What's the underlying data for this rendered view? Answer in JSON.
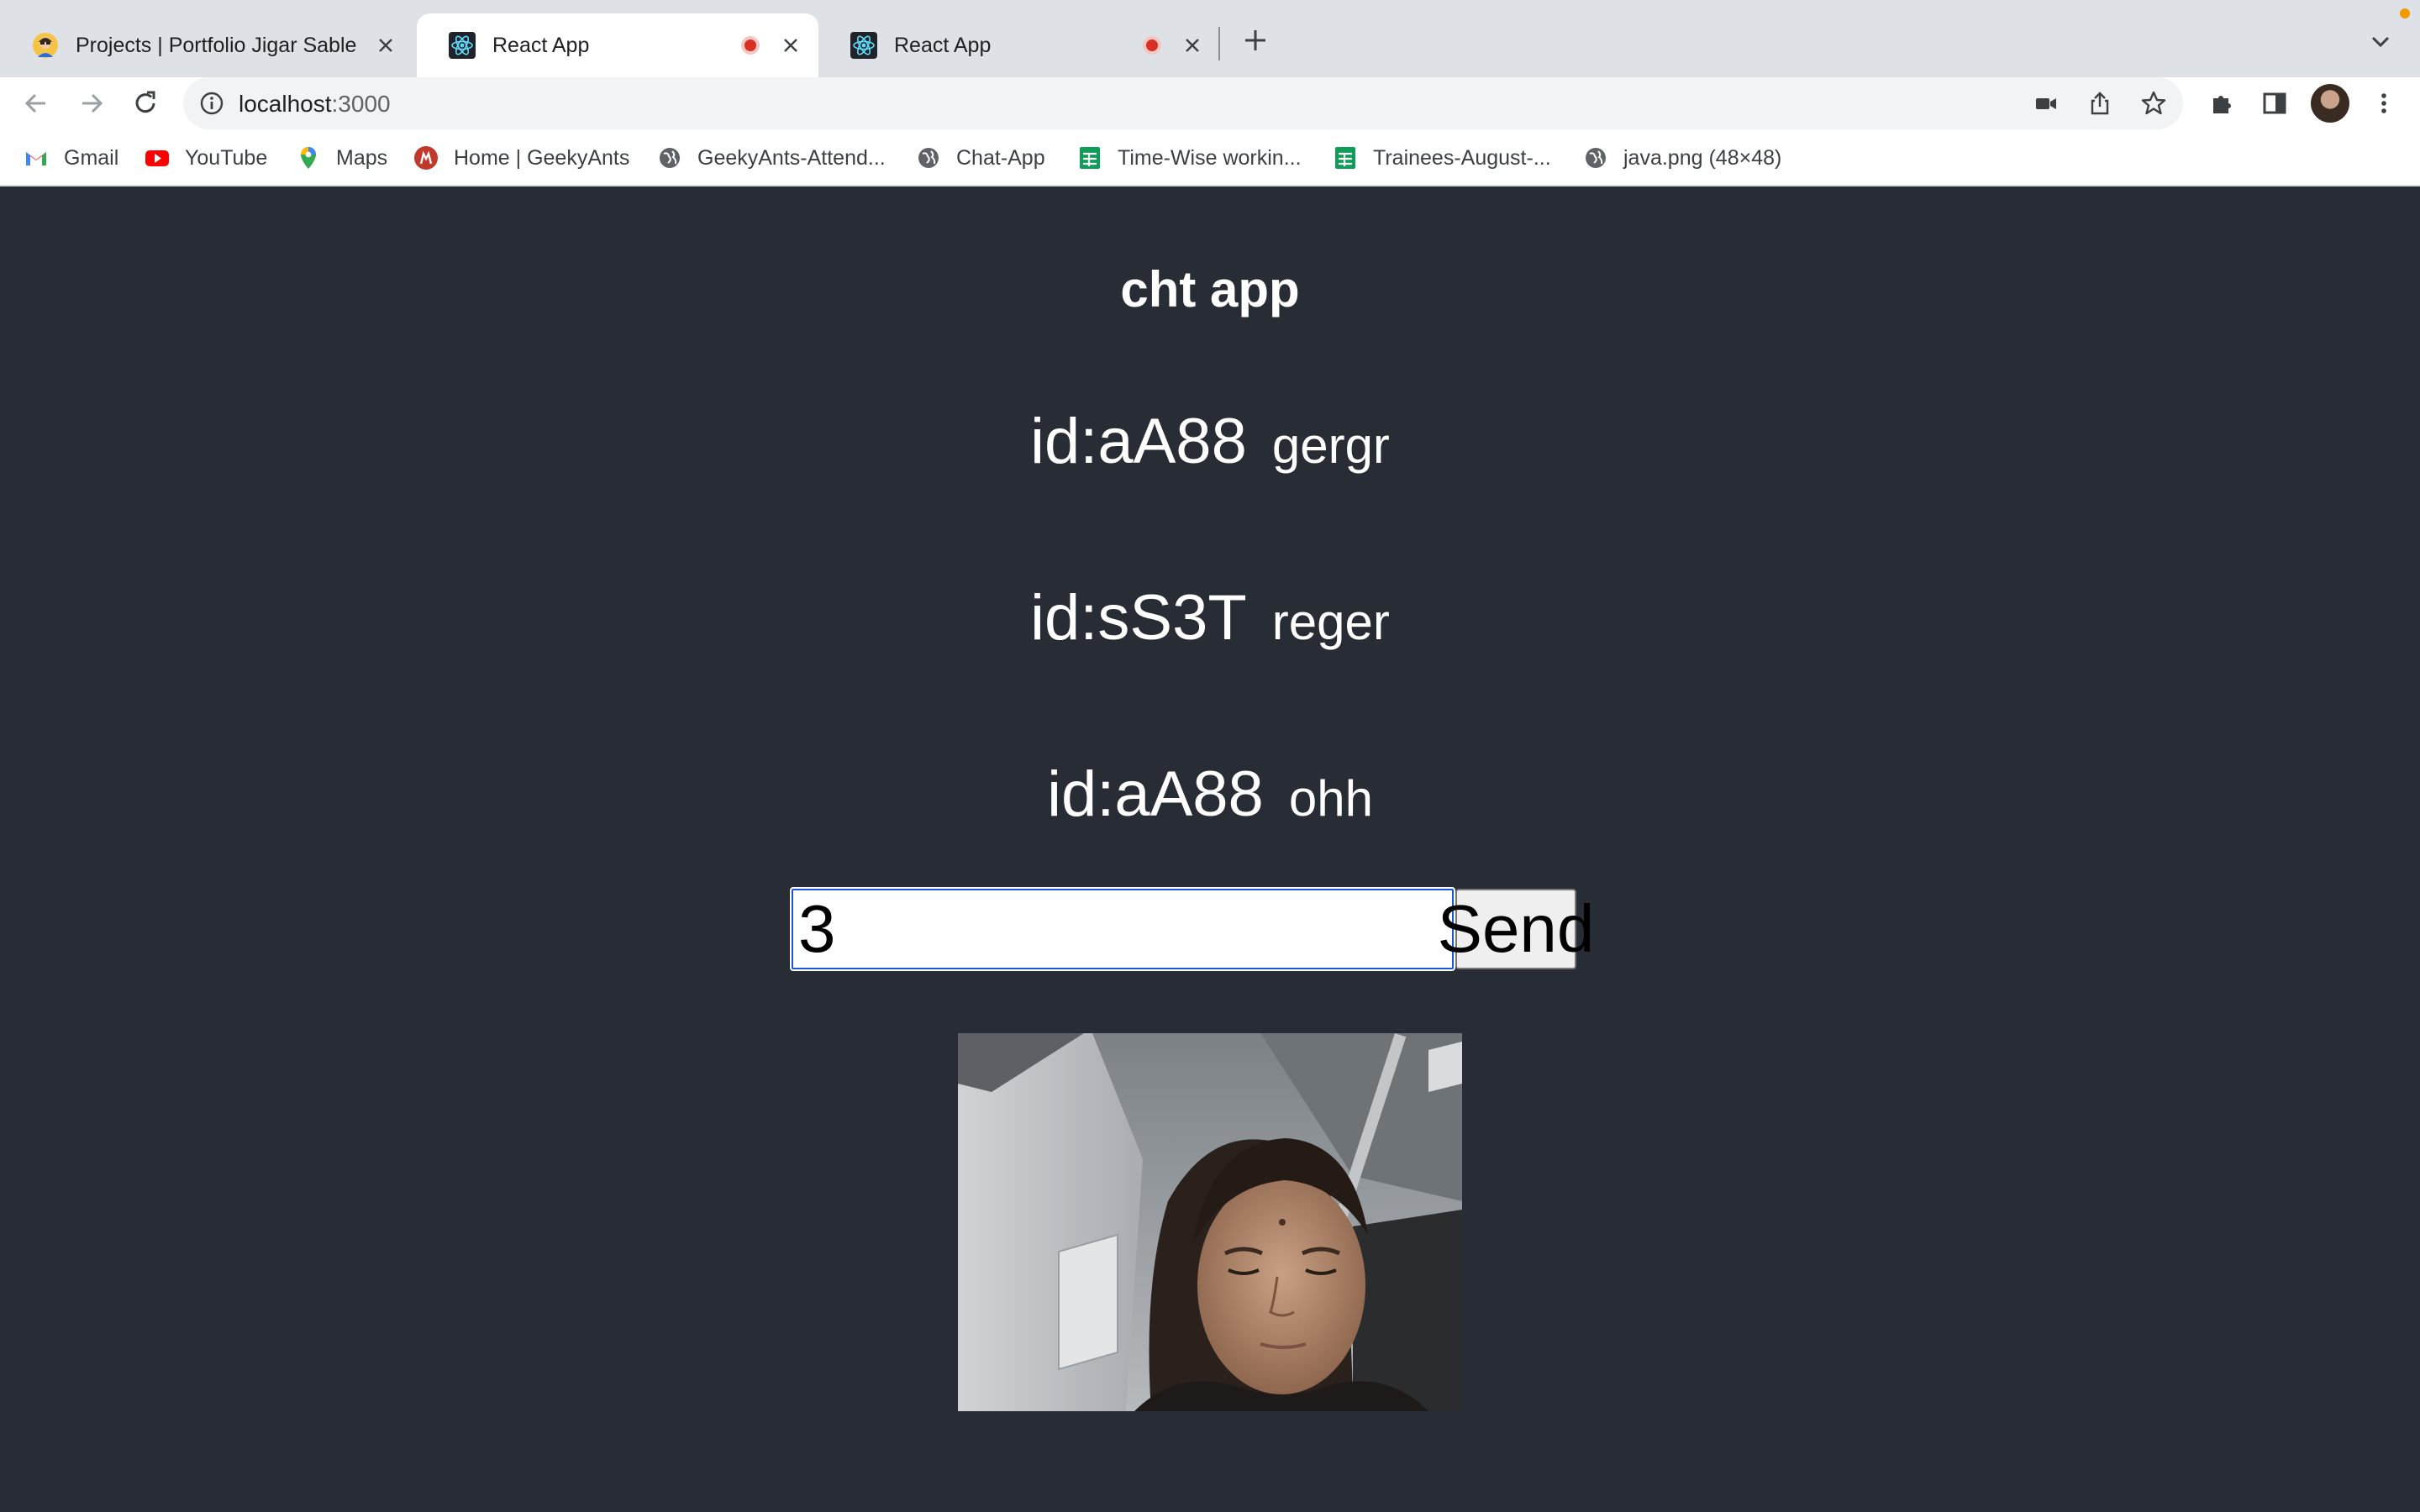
{
  "browser": {
    "tabs": [
      {
        "title": "Projects | Portfolio Jigar Sable",
        "active": false,
        "recording": false
      },
      {
        "title": "React App",
        "active": true,
        "recording": true
      },
      {
        "title": "React App",
        "active": false,
        "recording": true
      }
    ],
    "address": {
      "host": "localhost",
      "port": ":3000"
    },
    "bookmarks": [
      {
        "label": "Gmail",
        "icon": "gmail-icon"
      },
      {
        "label": "YouTube",
        "icon": "youtube-icon"
      },
      {
        "label": "Maps",
        "icon": "maps-icon"
      },
      {
        "label": "Home | GeekyAnts",
        "icon": "geekyants-icon"
      },
      {
        "label": "GeekyAnts-Attend...",
        "icon": "globe-icon"
      },
      {
        "label": "Chat-App",
        "icon": "globe-icon"
      },
      {
        "label": "Time-Wise workin...",
        "icon": "sheets-icon"
      },
      {
        "label": "Trainees-August-...",
        "icon": "sheets-icon"
      },
      {
        "label": "java.png (48×48)",
        "icon": "globe-icon"
      }
    ]
  },
  "app": {
    "title": "cht app",
    "messages": [
      {
        "id": "id:aA88",
        "text": "gergr"
      },
      {
        "id": "id:sS3T",
        "text": "reger"
      },
      {
        "id": "id:aA88",
        "text": "ohh"
      }
    ],
    "input_value": "3",
    "send_label": "Send"
  },
  "colors": {
    "page_background": "#282c34",
    "input_focus": "#1a56db",
    "recording": "#d93025"
  }
}
